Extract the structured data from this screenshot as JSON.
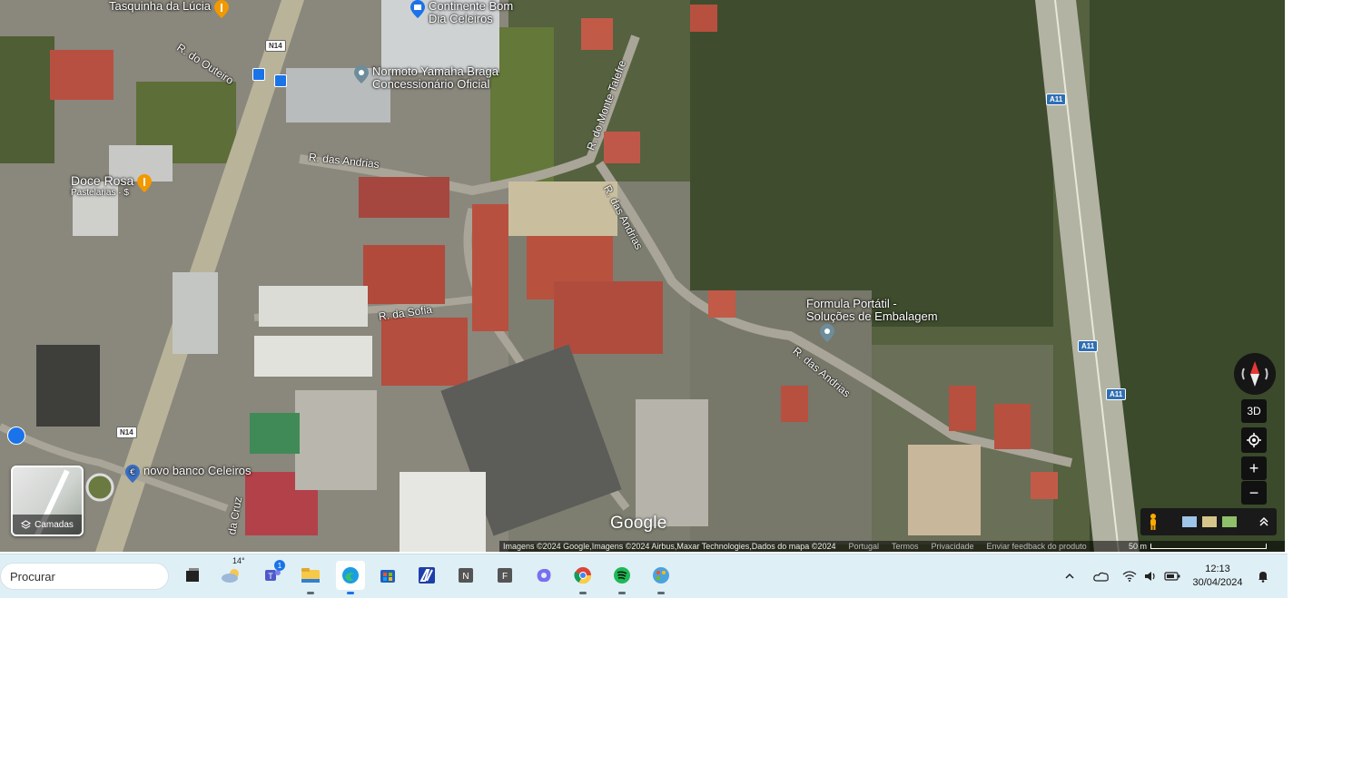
{
  "map": {
    "places": [
      {
        "name": "Tasquinha da Lúcia",
        "sub": "",
        "icon": "restaurant-pin-icon"
      },
      {
        "name": "Continente Bom",
        "sub": "Dia Celeiros",
        "icon": "shopping-pin-icon"
      },
      {
        "name": "Normoto Yamaha Braga",
        "sub": "Concessionário Oficial",
        "icon": "place-pin-icon"
      },
      {
        "name": "Doce Rosa",
        "sub": "Pastelarias · $",
        "icon": "restaurant-pin-icon"
      },
      {
        "name": "Formula Portátil -",
        "sub": "Soluções de Embalagem",
        "icon": "place-pin-icon"
      },
      {
        "name": "novo banco Celeiros",
        "sub": "",
        "icon": "bank-pin-icon"
      }
    ],
    "streets": [
      "R. do Outeiro",
      "R. das Andrias",
      "R. do Monte Talefre",
      "R. das Andrias",
      "R. da Sofia",
      "R. das Andrias",
      "da Cruz"
    ],
    "road_shields": [
      "N14",
      "A11",
      "A11",
      "A11",
      "N14"
    ],
    "google_logo": "Google",
    "attribution": "Imagens ©2024 Google,Imagens ©2024 Airbus,Maxar Technologies,Dados do mapa ©2024",
    "links": [
      "Portugal",
      "Termos",
      "Privacidade",
      "Enviar feedback do produto"
    ],
    "scale_label": "50 m",
    "layers_label": "Camadas",
    "controls": {
      "tilt": "3D",
      "zoom_in": "+",
      "zoom_out": "−"
    }
  },
  "taskbar": {
    "search_placeholder": "Procurar",
    "weather_temp": "14°",
    "teams_badge": "1",
    "apps": [
      "task-view-icon",
      "weather-icon",
      "teams-icon",
      "file-explorer-icon",
      "edge-icon",
      "store-icon",
      "app-blue-icon",
      "notion-icon",
      "app-f-icon",
      "copilot-icon",
      "chrome-icon",
      "spotify-icon",
      "paint-icon"
    ],
    "time": "12:13",
    "date": "30/04/2024"
  }
}
